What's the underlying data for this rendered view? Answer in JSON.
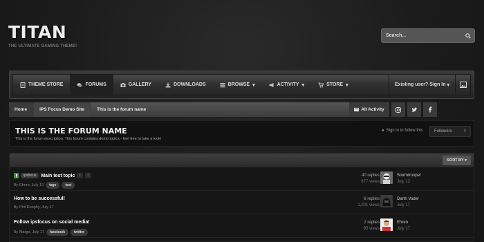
{
  "brand": {
    "title": "TITAN",
    "tagline": "THE ULTIMATE GAMING THEME!"
  },
  "search": {
    "placeholder": "Search..."
  },
  "nav": {
    "items": [
      {
        "label": "THEME STORE",
        "icon": "document-icon",
        "active": false
      },
      {
        "label": "FORUMS",
        "icon": "comments-icon",
        "active": true
      },
      {
        "label": "GALLERY",
        "icon": "camera-icon",
        "active": false
      },
      {
        "label": "DOWNLOADS",
        "icon": "download-icon",
        "active": false
      },
      {
        "label": "BROWSE",
        "icon": "list-icon",
        "active": false,
        "dropdown": true
      },
      {
        "label": "ACTIVITY",
        "icon": "megaphone-icon",
        "active": false,
        "dropdown": true
      },
      {
        "label": "STORE",
        "icon": "cart-icon",
        "active": false,
        "dropdown": true
      }
    ],
    "signin": "Existing user? Sign In"
  },
  "breadcrumb": {
    "items": [
      "Home",
      "IPS Focus Demo Site",
      "This is the forum name"
    ],
    "activity": "All Activity"
  },
  "forum": {
    "title": "THIS IS THE FORUM NAME",
    "description": "This is the forum description. This forum contains demo topics - feel free to take a look!",
    "follow_text": "Sign in to follow this",
    "followers_label": "Followers",
    "followers_count": "0"
  },
  "list": {
    "sort_label": "SORT BY",
    "topics": [
      {
        "badge": "ipsfocus",
        "title": "Main test topic",
        "pages": [
          "1",
          "2"
        ],
        "meta": "By Ehren, July 12",
        "tags": [
          "tags",
          "test"
        ],
        "replies": "40 replies",
        "views": "677 views",
        "last_user": "Stormtrooper",
        "last_date": "July 12",
        "pinned": true
      },
      {
        "title": "How to be successful!",
        "meta": "By Phil Dunphy, July 17",
        "tags": [],
        "replies": "6 replies",
        "views": "1,201 views",
        "last_user": "Darth Vader",
        "last_date": "July 17"
      },
      {
        "title": "Follow ipsfocus on social media!",
        "meta": "By Marge, July 17",
        "tags": [
          "facebook",
          "twitter"
        ],
        "replies": "2 replies",
        "views": "95 views",
        "last_user": "Ehren",
        "last_date": "July 17"
      }
    ]
  }
}
